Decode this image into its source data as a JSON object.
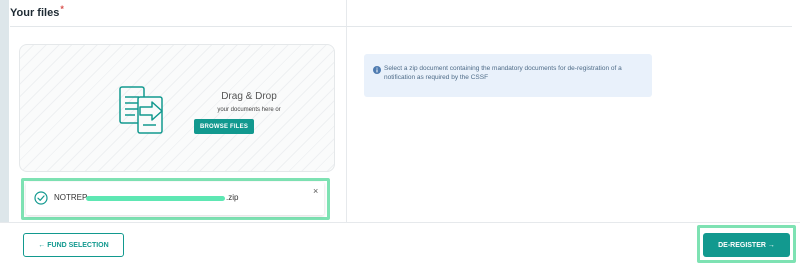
{
  "section": {
    "title": "Your files",
    "required_marker": "*"
  },
  "dropzone": {
    "title": "Drag & Drop",
    "subtitle": "your documents here or",
    "browse_label": "BROWSE FILES"
  },
  "uploaded_file": {
    "name_prefix": "NOTREP",
    "name_suffix": ".zip",
    "close_symbol": "×"
  },
  "info": {
    "text": "Select a zip document containing the mandatory documents for de-registration of a notification as required by the CSSF"
  },
  "footer": {
    "back_label": "← FUND SELECTION",
    "submit_label": "DE-REGISTER →"
  },
  "colors": {
    "accent": "#12998f",
    "highlight": "#7ee2b3",
    "info_bg": "#e9f1fb"
  },
  "icons": [
    "document-upload-icon",
    "check-circle-icon",
    "info-icon",
    "close-icon"
  ]
}
